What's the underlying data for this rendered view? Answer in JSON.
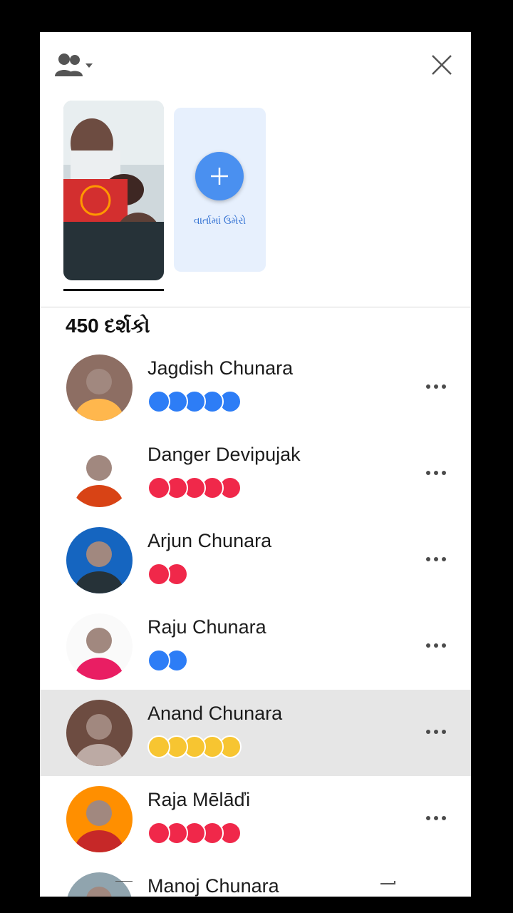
{
  "header": {
    "people_icon": "people-dropdown-icon",
    "close_icon": "close-icon"
  },
  "stories": {
    "add_label": "વાર્તામાં ઉમેરો",
    "add_icon": "plus-icon"
  },
  "viewers": {
    "count_label": "450 દર્શકો",
    "items": [
      {
        "name": "Jagdish Chunara",
        "reaction": "like",
        "count": 5,
        "highlight": false
      },
      {
        "name": "Danger Devipujak",
        "reaction": "love",
        "count": 5,
        "highlight": false
      },
      {
        "name": "Arjun Chunara",
        "reaction": "love",
        "count": 2,
        "highlight": false
      },
      {
        "name": "Raju Chunara",
        "reaction": "like",
        "count": 2,
        "highlight": false
      },
      {
        "name": "Anand Chunara",
        "reaction": "care",
        "count": 5,
        "highlight": true
      },
      {
        "name": "Raja Mēlāďi",
        "reaction": "love",
        "count": 5,
        "highlight": false
      },
      {
        "name": "Manoj Chunara",
        "reaction": "",
        "count": 0,
        "highlight": false
      }
    ]
  },
  "colors": {
    "like": "#2d7df6",
    "love": "#f0284a",
    "care": "#f7c531",
    "accent": "#4a90f0"
  }
}
